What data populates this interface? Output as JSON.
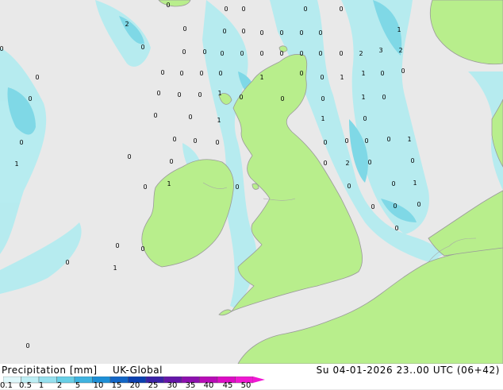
{
  "title": "Precipitation [mm]",
  "model": "UK-Global",
  "datetime": "Su 04-01-2026 23..00 UTC (06+42)",
  "colors": {
    "sea": "#e9e9e9",
    "land": "#b8ee8c",
    "coast": "#9a9a9a",
    "precip_light": "#b4ecf0",
    "precip_mid": "#7fd8e6",
    "precip_heavy": "#4fb6dc"
  },
  "legend": {
    "labels": [
      "0.1",
      "0.5",
      "1",
      "2",
      "5",
      "10",
      "15",
      "20",
      "25",
      "30",
      "35",
      "40",
      "45",
      "50"
    ],
    "colors": [
      "#dff8fb",
      "#bdeef4",
      "#96e0ee",
      "#68cfe6",
      "#3fb3e0",
      "#1d8fd6",
      "#1366c6",
      "#0b40b0",
      "#3a22a6",
      "#6416a8",
      "#8c10ae",
      "#b70cb6",
      "#dc0cc4",
      "#f018d2"
    ]
  },
  "point_values": [
    "0",
    "0",
    "0",
    "0",
    "2",
    "0",
    "0",
    "0",
    "0",
    "0",
    "0",
    "0",
    "0",
    "0",
    "0",
    "0",
    "0",
    "0",
    "0",
    "0",
    "0",
    "0",
    "0",
    "2",
    "3",
    "2",
    "1",
    "0",
    "0",
    "0",
    "0",
    "0",
    "0",
    "1",
    "0",
    "0",
    "1",
    "1",
    "0",
    "0",
    "0",
    "0",
    "0",
    "0",
    "1",
    "0",
    "0",
    "0",
    "1",
    "0",
    "0",
    "0",
    "1",
    "1",
    "0",
    "0",
    "0",
    "0",
    "0",
    "0",
    "0",
    "0",
    "0",
    "1",
    "0",
    "0",
    "0",
    "2",
    "0",
    "0",
    "1",
    "0",
    "1",
    "0",
    "0",
    "0",
    "1",
    "0",
    "0",
    "0",
    "0",
    "0",
    "0",
    "0",
    "1",
    "0"
  ]
}
